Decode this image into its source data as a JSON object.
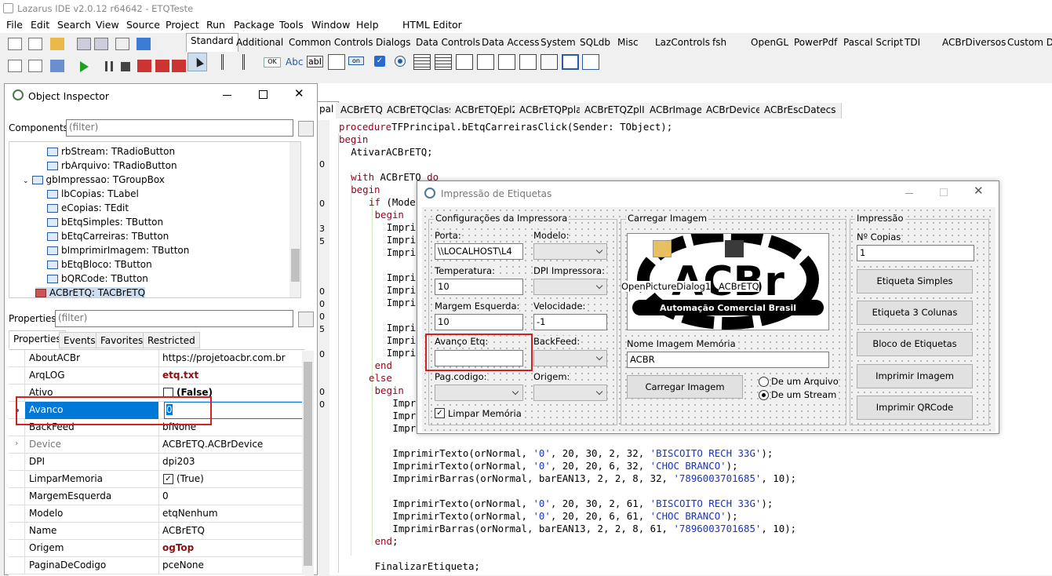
{
  "window": {
    "title": "Lazarus IDE v2.0.12 r64642 - ETQTeste"
  },
  "menu": [
    "File",
    "Edit",
    "Search",
    "View",
    "Source",
    "Project",
    "Run",
    "Package",
    "Tools",
    "Window",
    "Help",
    "HTML Editor"
  ],
  "palette_tabs": [
    "Standard",
    "Additional",
    "Common Controls",
    "Dialogs",
    "Data Controls",
    "Data Access",
    "System",
    "SQLdb",
    "Misc",
    "LazControls",
    "fsh",
    "OpenGL",
    "PowerPdf",
    "Pascal Script",
    "TDI",
    "ACBrDiversos",
    "Custom Dr"
  ],
  "palette_items": {
    "ok_label": "OK",
    "abc_label": "Abc",
    "abi_label": "abI",
    "on_label": "on"
  },
  "object_inspector": {
    "title": "Object Inspector",
    "components_label": "Components",
    "filter_placeholder": "(filter)",
    "tree": [
      "rbStream: TRadioButton",
      "rbArquivo: TRadioButton",
      "gbImpressao: TGroupBox",
      "lbCopias: TLabel",
      "eCopias: TEdit",
      "bEtqSimples: TButton",
      "bEtqCarreiras: TButton",
      "bImprimirImagem: TButton",
      "bEtqBloco: TButton",
      "bQRCode: TButton",
      "ACBrETQ: TACBrETQ"
    ],
    "properties_label": "Properties",
    "tabs": [
      "Properties",
      "Events",
      "Favorites",
      "Restricted"
    ],
    "props": [
      {
        "k": "AboutACBr",
        "v": "https://projetoacbr.com.br"
      },
      {
        "k": "ArqLOG",
        "v": "etq.txt"
      },
      {
        "k": "Ativo",
        "v": "(False)"
      },
      {
        "k": "Avanco",
        "v": "0"
      },
      {
        "k": "BackFeed",
        "v": "bfNone"
      },
      {
        "k": "Device",
        "v": "ACBrETQ.ACBrDevice"
      },
      {
        "k": "DPI",
        "v": "dpi203"
      },
      {
        "k": "LimparMemoria",
        "v": "(True)"
      },
      {
        "k": "MargemEsquerda",
        "v": "0"
      },
      {
        "k": "Modelo",
        "v": "etqNenhum"
      },
      {
        "k": "Name",
        "v": "ACBrETQ"
      },
      {
        "k": "Origem",
        "v": "ogTop"
      },
      {
        "k": "PaginaDeCodigo",
        "v": "pceNone"
      }
    ]
  },
  "editor_tabs": [
    "pal",
    "ACBrETQ",
    "ACBrETQClass",
    "ACBrETQEpl2",
    "ACBrETQPpla",
    "ACBrETQZplII",
    "ACBrImage",
    "ACBrDevice",
    "ACBrEscDatecs"
  ],
  "gutter_digits": [
    "0",
    "0",
    "3",
    "5",
    "0",
    "0",
    "0",
    "5",
    "0",
    "0",
    "0"
  ],
  "code": [
    {
      "i": 0,
      "parts": [
        [
          "kw",
          "procedure"
        ],
        [
          "",
          "TFPrincipal.bEtqCarreirasClick(Sender: TObject);"
        ]
      ]
    },
    {
      "i": 0,
      "parts": [
        [
          "kw",
          "begin"
        ]
      ]
    },
    {
      "i": 2,
      "parts": [
        [
          "",
          "AtivarACBrETQ;"
        ]
      ]
    },
    {
      "i": 0,
      "parts": []
    },
    {
      "i": 2,
      "parts": [
        [
          "kw",
          "with"
        ],
        [
          "",
          " ACBrETQ "
        ],
        [
          "kw",
          "do"
        ]
      ]
    },
    {
      "i": 2,
      "parts": [
        [
          "kw",
          "begin"
        ]
      ]
    },
    {
      "i": 5,
      "parts": [
        [
          "kw",
          "if"
        ],
        [
          "",
          " (Mode"
        ]
      ]
    },
    {
      "i": 6,
      "parts": [
        [
          "kw",
          "begin"
        ]
      ]
    },
    {
      "i": 8,
      "parts": [
        [
          "",
          "Impri"
        ]
      ]
    },
    {
      "i": 8,
      "parts": [
        [
          "",
          "Impri"
        ]
      ]
    },
    {
      "i": 8,
      "parts": [
        [
          "",
          "Impri"
        ]
      ]
    },
    {
      "i": 0,
      "parts": []
    },
    {
      "i": 8,
      "parts": [
        [
          "",
          "Impri"
        ]
      ]
    },
    {
      "i": 8,
      "parts": [
        [
          "",
          "Impri"
        ]
      ]
    },
    {
      "i": 8,
      "parts": [
        [
          "",
          "Impri"
        ]
      ]
    },
    {
      "i": 0,
      "parts": []
    },
    {
      "i": 8,
      "parts": [
        [
          "",
          "Impri"
        ]
      ]
    },
    {
      "i": 8,
      "parts": [
        [
          "",
          "Impri"
        ]
      ]
    },
    {
      "i": 8,
      "parts": [
        [
          "",
          "Impri"
        ]
      ]
    },
    {
      "i": 6,
      "parts": [
        [
          "kw",
          "end"
        ]
      ]
    },
    {
      "i": 5,
      "parts": [
        [
          "kw",
          "else"
        ]
      ]
    },
    {
      "i": 6,
      "parts": [
        [
          "kw",
          "begin"
        ]
      ]
    },
    {
      "i": 9,
      "parts": [
        [
          "",
          "Impri"
        ]
      ]
    },
    {
      "i": 9,
      "parts": [
        [
          "",
          "Impri"
        ]
      ]
    },
    {
      "i": 9,
      "parts": [
        [
          "",
          "Impri"
        ]
      ]
    },
    {
      "i": 0,
      "parts": []
    },
    {
      "i": 9,
      "parts": [
        [
          "",
          "ImprimirTexto(orNormal, "
        ],
        [
          "str",
          "'0'"
        ],
        [
          "",
          ", 20, 30, 2, 32, "
        ],
        [
          "str",
          "'BISCOITO RECH 33G'"
        ],
        [
          "",
          ");"
        ]
      ]
    },
    {
      "i": 9,
      "parts": [
        [
          "",
          "ImprimirTexto(orNormal, "
        ],
        [
          "str",
          "'0'"
        ],
        [
          "",
          ", 20, 20, 6, 32, "
        ],
        [
          "str",
          "'CHOC BRANCO'"
        ],
        [
          "",
          ");"
        ]
      ]
    },
    {
      "i": 9,
      "parts": [
        [
          "",
          "ImprimirBarras(orNormal, barEAN13, 2, 2, 8, 32, "
        ],
        [
          "str",
          "'7896003701685'"
        ],
        [
          "",
          ", 10);"
        ]
      ]
    },
    {
      "i": 0,
      "parts": []
    },
    {
      "i": 9,
      "parts": [
        [
          "",
          "ImprimirTexto(orNormal, "
        ],
        [
          "str",
          "'0'"
        ],
        [
          "",
          ", 20, 30, 2, 61, "
        ],
        [
          "str",
          "'BISCOITO RECH 33G'"
        ],
        [
          "",
          ");"
        ]
      ]
    },
    {
      "i": 9,
      "parts": [
        [
          "",
          "ImprimirTexto(orNormal, "
        ],
        [
          "str",
          "'0'"
        ],
        [
          "",
          ", 20, 20, 6, 61, "
        ],
        [
          "str",
          "'CHOC BRANCO'"
        ],
        [
          "",
          ");"
        ]
      ]
    },
    {
      "i": 9,
      "parts": [
        [
          "",
          "ImprimirBarras(orNormal, barEAN13, 2, 2, 8, 61, "
        ],
        [
          "str",
          "'7896003701685'"
        ],
        [
          "",
          ", 10);"
        ]
      ]
    },
    {
      "i": 6,
      "parts": [
        [
          "kw",
          "end"
        ],
        [
          "",
          ";"
        ]
      ]
    },
    {
      "i": 0,
      "parts": []
    },
    {
      "i": 6,
      "parts": [
        [
          "",
          "FinalizarEtiqueta;"
        ]
      ]
    }
  ],
  "form": {
    "title": "Impressão de Etiquetas",
    "cfg": {
      "caption": "Configurações da Impressora",
      "porta_label": "Porta:",
      "porta_value": "\\\\LOCALHOST\\L4",
      "modelo_label": "Modelo:",
      "temp_label": "Temperatura:",
      "temp_value": "10",
      "dpi_label": "DPI Impressora:",
      "margem_label": "Margem Esquerda:",
      "margem_value": "10",
      "vel_label": "Velocidade:",
      "vel_value": "-1",
      "avanco_label": "Avanço Etq:",
      "avanco_value": "",
      "backfeed_label": "BackFeed:",
      "pag_label": "Pag.codigo:",
      "origem_label": "Origem:",
      "limpar_label": "Limpar Memória"
    },
    "img": {
      "caption": "Carregar Imagem",
      "dialog_label": "OpenPictureDialog1",
      "acbretq_label": "ACBrETQ",
      "logo_text": "ACBr",
      "logo_sub": "Automação Comercial Brasil",
      "nome_label": "Nome Imagem Memória",
      "nome_value": "ACBR",
      "carregar_button": "Carregar Imagem",
      "radio_arquivo": "De um Arquivo",
      "radio_stream": "De um Stream"
    },
    "imp": {
      "caption": "Impressão",
      "copias_label": "Nº Copias",
      "copias_value": "1",
      "buttons": [
        "Etiqueta Simples",
        "Etiqueta 3 Colunas",
        "Bloco de Etiquetas",
        "Imprimir Imagem",
        "Imprimir QRCode"
      ]
    }
  }
}
